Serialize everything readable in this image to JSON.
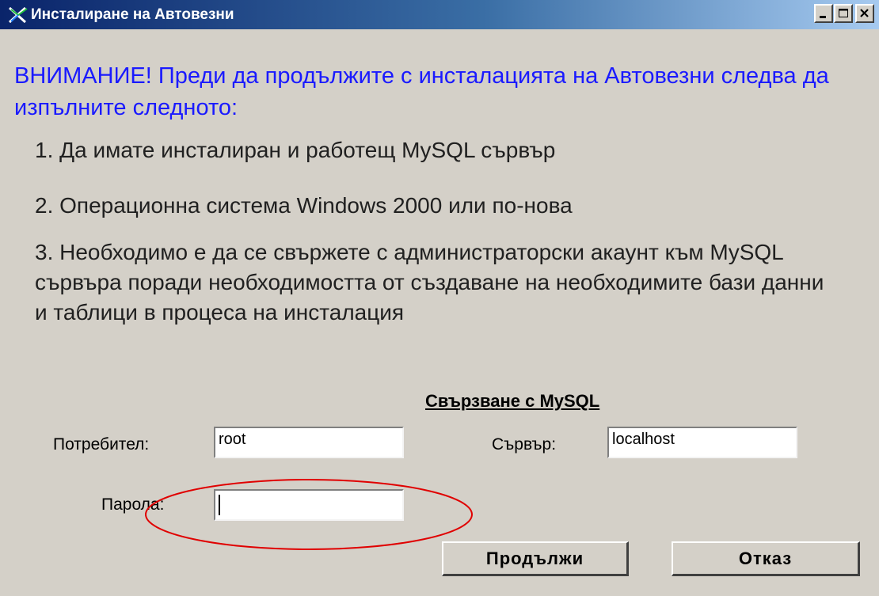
{
  "window": {
    "title": "Инсталиране на Автовезни",
    "controls": [
      "minimize",
      "maximize",
      "close"
    ]
  },
  "warning": {
    "text": "ВНИМАНИЕ!   Преди да продължите с инсталацията на Автовезни следва да изпълните следното:",
    "color": "#1a1aff"
  },
  "requirements": [
    "1. Да имате инсталиран и работещ MySQL сървър",
    "2. Операционна система Windows 2000 или по-нова",
    "3. Необходимо е да се свържете с администраторски акаунт към MySQL сървъра поради необходимостта от създаване на необходимите бази данни и таблици в процеса на инсталация"
  ],
  "connection": {
    "title": "Свързване с MySQL",
    "user_label": "Потребител:",
    "user_value": "root",
    "server_label": "Сървър:",
    "server_value": "localhost",
    "password_label": "Парола:",
    "password_value": ""
  },
  "buttons": {
    "continue": "Продължи",
    "cancel": "Отказ"
  },
  "annotation": {
    "shape": "ellipse",
    "color": "#e00000",
    "target": "password-field"
  },
  "colors": {
    "face": "#d4d0c8",
    "title_start": "#0a246a",
    "title_end": "#a6caf0"
  }
}
